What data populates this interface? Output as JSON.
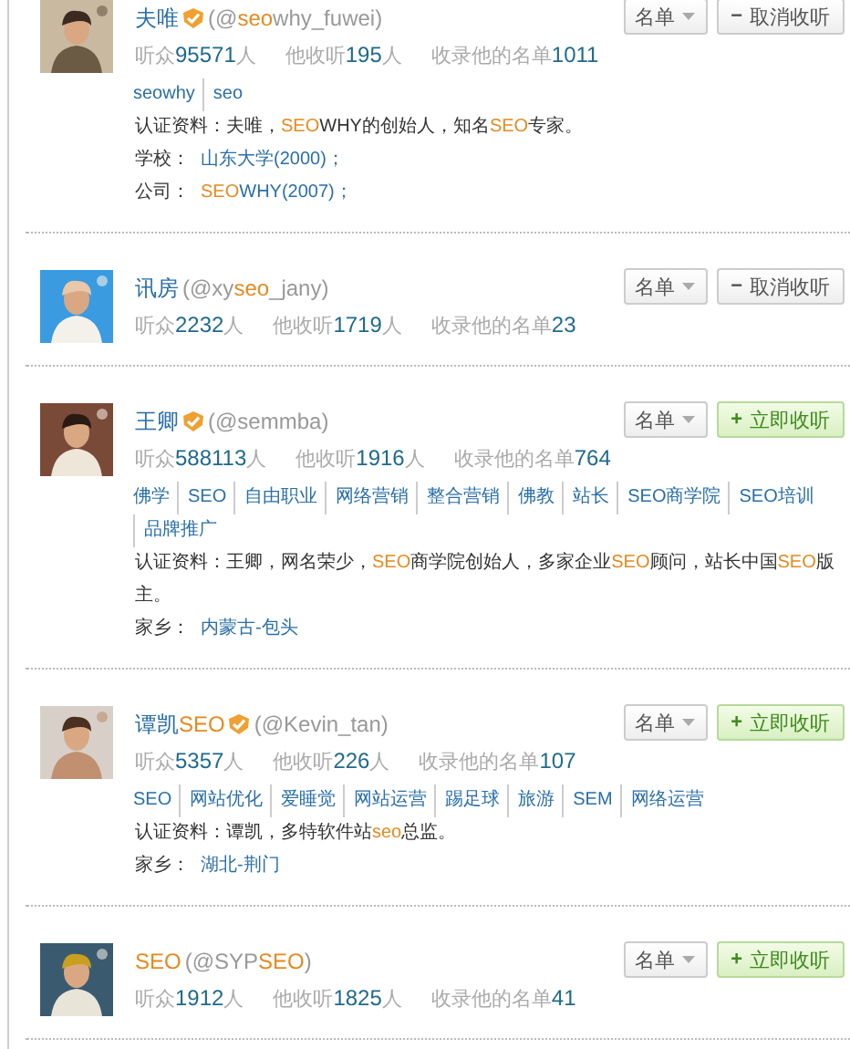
{
  "users": [
    {
      "name": [
        {
          "text": "夫唯",
          "highlight": false
        }
      ],
      "verified": true,
      "handle": [
        {
          "text": "(@",
          "highlight": false
        },
        {
          "text": "seo",
          "highlight": true
        },
        {
          "text": "why_fuwei)",
          "highlight": false
        }
      ],
      "avatar": {
        "kind": "picture"
      },
      "list_button": "名单",
      "follow_button": {
        "label": "取消收听",
        "sign": "−",
        "following": true
      },
      "stats": [
        {
          "label": "听众",
          "value": "95571",
          "unit": "人"
        },
        {
          "label": "他收听",
          "value": "195",
          "unit": "人"
        },
        {
          "label": "收录他的名单",
          "value": "1011"
        }
      ],
      "tags": [
        "seowhy",
        "seo"
      ],
      "bio": [
        {
          "text": "认证资料：夫唯，",
          "highlight": false
        },
        {
          "text": "SEO",
          "highlight": true
        },
        {
          "text": "WHY的创始人，知名",
          "highlight": false
        },
        {
          "text": "SEO",
          "highlight": true
        },
        {
          "text": "专家。",
          "highlight": false
        }
      ],
      "info": [
        {
          "label": "学校：",
          "value": [
            {
              "text": "山东大学(2000)；",
              "highlight": false
            }
          ]
        },
        {
          "label": "公司：",
          "value": [
            {
              "text": "SEO",
              "highlight": true
            },
            {
              "text": "WHY(2007)；",
              "highlight": false
            }
          ]
        }
      ]
    },
    {
      "name": [
        {
          "text": "讯房",
          "highlight": false
        }
      ],
      "verified": false,
      "handle": [
        {
          "text": "(@xy",
          "highlight": false
        },
        {
          "text": "seo",
          "highlight": true
        },
        {
          "text": "_jany)",
          "highlight": false
        }
      ],
      "avatar": {
        "kind": "picture"
      },
      "list_button": "名单",
      "follow_button": {
        "label": "取消收听",
        "sign": "−",
        "following": true
      },
      "stats": [
        {
          "label": "听众",
          "value": "2232",
          "unit": "人"
        },
        {
          "label": "他收听",
          "value": "1719",
          "unit": "人"
        },
        {
          "label": "收录他的名单",
          "value": "23"
        }
      ]
    },
    {
      "name": [
        {
          "text": "王卿",
          "highlight": false
        }
      ],
      "verified": true,
      "handle": [
        {
          "text": "(@semmba)",
          "highlight": false
        }
      ],
      "avatar": {
        "kind": "picture"
      },
      "list_button": "名单",
      "follow_button": {
        "label": "立即收听",
        "sign": "+",
        "following": false
      },
      "stats": [
        {
          "label": "听众",
          "value": "588113",
          "unit": "人"
        },
        {
          "label": "他收听",
          "value": "1916",
          "unit": "人"
        },
        {
          "label": "收录他的名单",
          "value": "764"
        }
      ],
      "tags": [
        "佛学",
        "SEO",
        "自由职业",
        "网络营销",
        "整合营销",
        "佛教",
        "站长",
        "SEO商学院",
        "SEO培训",
        "品牌推广"
      ],
      "bio": [
        {
          "text": "认证资料：王卿，网名荣少，",
          "highlight": false
        },
        {
          "text": "SEO",
          "highlight": true
        },
        {
          "text": "商学院创始人，多家企业",
          "highlight": false
        },
        {
          "text": "SEO",
          "highlight": true
        },
        {
          "text": "顾问，站长中国",
          "highlight": false
        },
        {
          "text": "SEO",
          "highlight": true
        },
        {
          "text": "版主。",
          "highlight": false
        }
      ],
      "info": [
        {
          "label": "家乡：",
          "value": [
            {
              "text": "内蒙古-包头",
              "highlight": false
            }
          ]
        }
      ]
    },
    {
      "name": [
        {
          "text": "谭凯",
          "highlight": false
        },
        {
          "text": "SEO",
          "highlight": true
        }
      ],
      "verified": true,
      "handle": [
        {
          "text": "(@Kevin_tan)",
          "highlight": false
        }
      ],
      "avatar": {
        "kind": "picture"
      },
      "list_button": "名单",
      "follow_button": {
        "label": "立即收听",
        "sign": "+",
        "following": false
      },
      "stats": [
        {
          "label": "听众",
          "value": "5357",
          "unit": "人"
        },
        {
          "label": "他收听",
          "value": "226",
          "unit": "人"
        },
        {
          "label": "收录他的名单",
          "value": "107"
        }
      ],
      "tags": [
        "SEO",
        "网站优化",
        "爱睡觉",
        "网站运营",
        "踢足球",
        "旅游",
        "SEM",
        "网络运营"
      ],
      "bio": [
        {
          "text": "认证资料：谭凯，多特软件站",
          "highlight": false
        },
        {
          "text": "seo",
          "highlight": true
        },
        {
          "text": "总监。",
          "highlight": false
        }
      ],
      "info": [
        {
          "label": "家乡：",
          "value": [
            {
              "text": "湖北-荆门",
              "highlight": false
            }
          ]
        }
      ]
    },
    {
      "name": [
        {
          "text": "SEO",
          "highlight": true
        }
      ],
      "verified": false,
      "handle": [
        {
          "text": "(@SYP",
          "highlight": false
        },
        {
          "text": "SEO",
          "highlight": true
        },
        {
          "text": ")",
          "highlight": false
        }
      ],
      "avatar": {
        "kind": "picture"
      },
      "list_button": "名单",
      "follow_button": {
        "label": "立即收听",
        "sign": "+",
        "following": false
      },
      "stats": [
        {
          "label": "听众",
          "value": "1912",
          "unit": "人"
        },
        {
          "label": "他收听",
          "value": "1825",
          "unit": "人"
        },
        {
          "label": "收录他的名单",
          "value": "41"
        }
      ]
    }
  ]
}
